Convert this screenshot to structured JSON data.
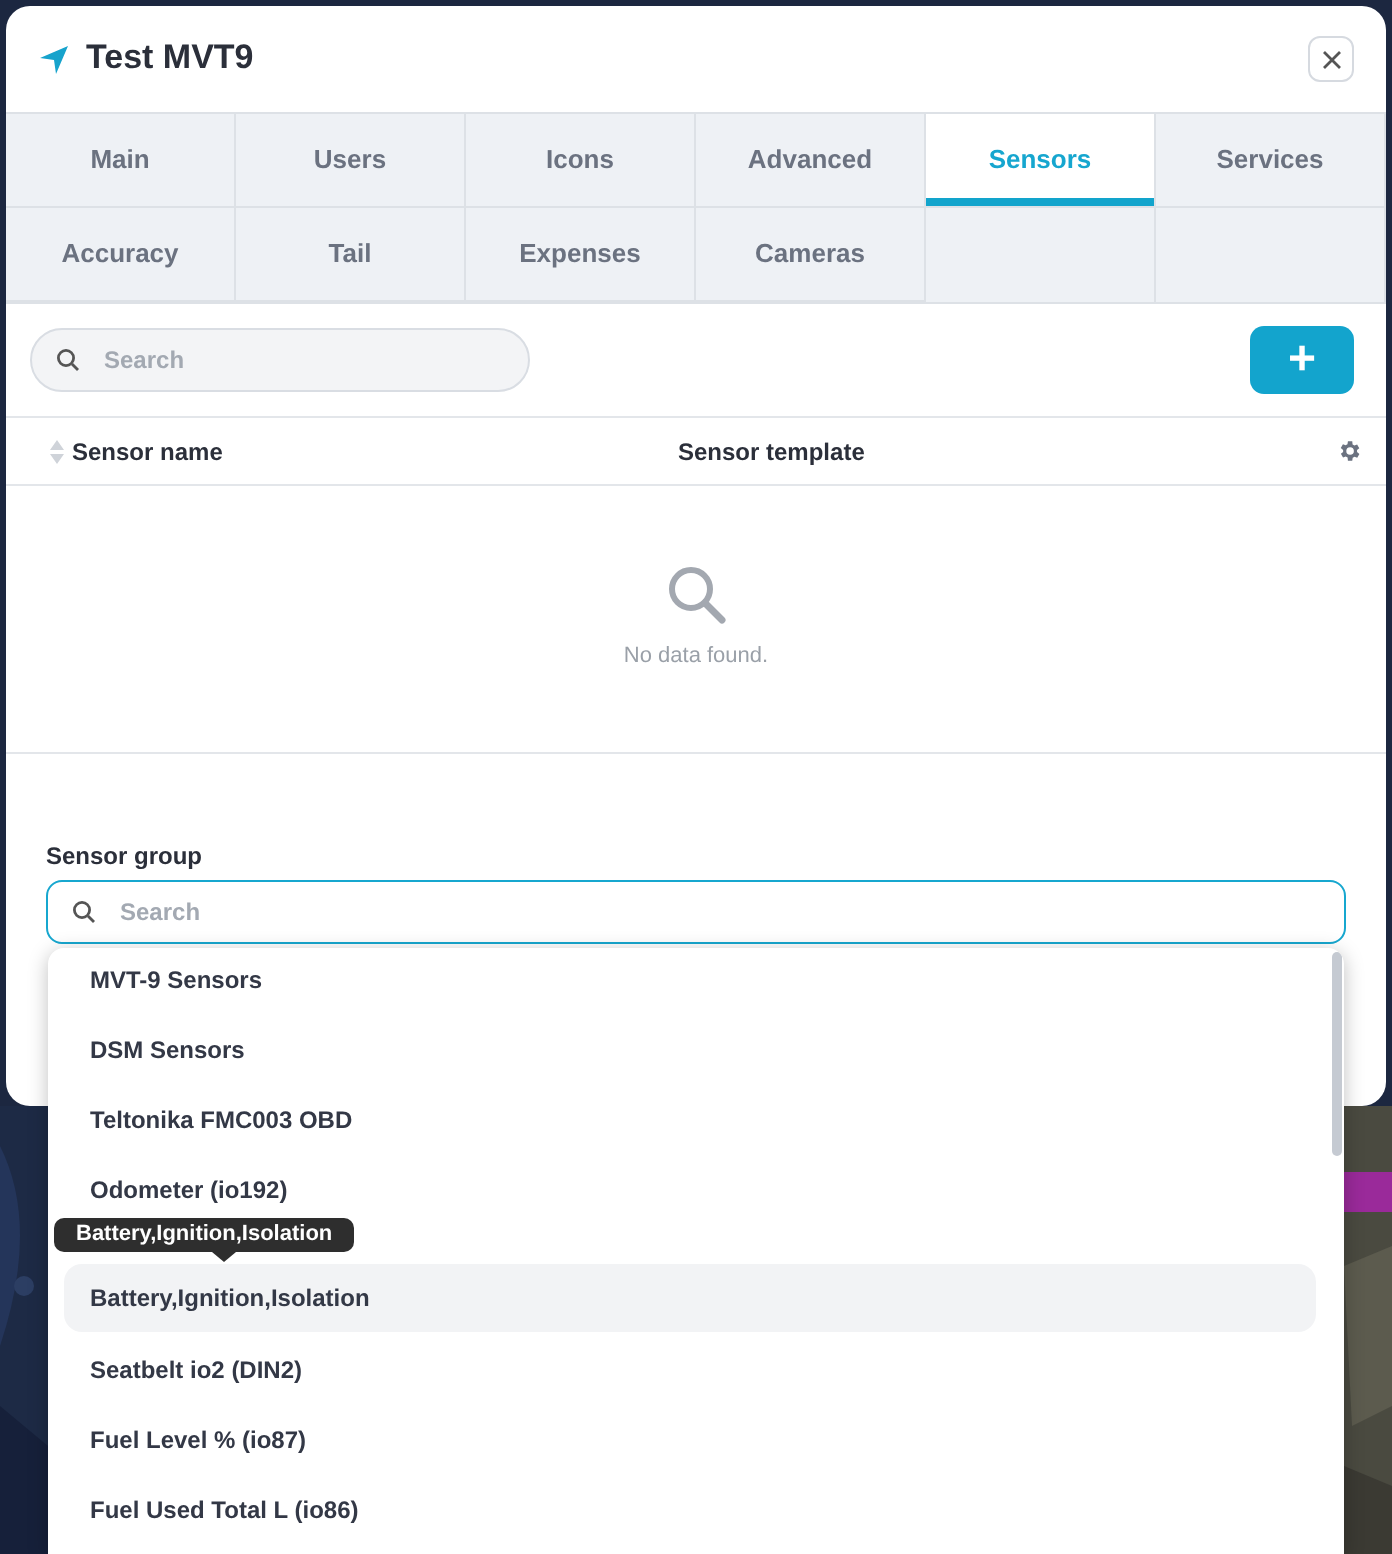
{
  "dialog": {
    "title": "Test MVT9"
  },
  "tabs": [
    {
      "label": "Main",
      "selected": false
    },
    {
      "label": "Users",
      "selected": false
    },
    {
      "label": "Icons",
      "selected": false
    },
    {
      "label": "Advanced",
      "selected": false
    },
    {
      "label": "Sensors",
      "selected": true
    },
    {
      "label": "Services",
      "selected": false
    },
    {
      "label": "Accuracy",
      "selected": false
    },
    {
      "label": "Tail",
      "selected": false
    },
    {
      "label": "Expenses",
      "selected": false
    },
    {
      "label": "Cameras",
      "selected": false
    }
  ],
  "search": {
    "placeholder": "Search"
  },
  "add_button": {
    "label": "+"
  },
  "table": {
    "columns": [
      {
        "label": "Sensor name",
        "sortable": true
      },
      {
        "label": "Sensor template"
      }
    ],
    "empty_message": "No data found."
  },
  "sensor_group": {
    "label": "Sensor group",
    "placeholder": "Search",
    "options": [
      {
        "label": "MVT-9 Sensors",
        "hovered": false
      },
      {
        "label": "DSM Sensors",
        "hovered": false
      },
      {
        "label": "Teltonika FMC003 OBD",
        "hovered": false
      },
      {
        "label": "Odometer (io192)",
        "hovered": false
      },
      {
        "label": "Battery,Ignition,Isolation",
        "hovered": true
      },
      {
        "label": "Seatbelt io2 (DIN2)",
        "hovered": false
      },
      {
        "label": "Fuel Level % (io87)",
        "hovered": false
      },
      {
        "label": "Fuel Used Total L (io86)",
        "hovered": false
      }
    ]
  },
  "tooltip": {
    "text": "Battery,Ignition,Isolation"
  }
}
